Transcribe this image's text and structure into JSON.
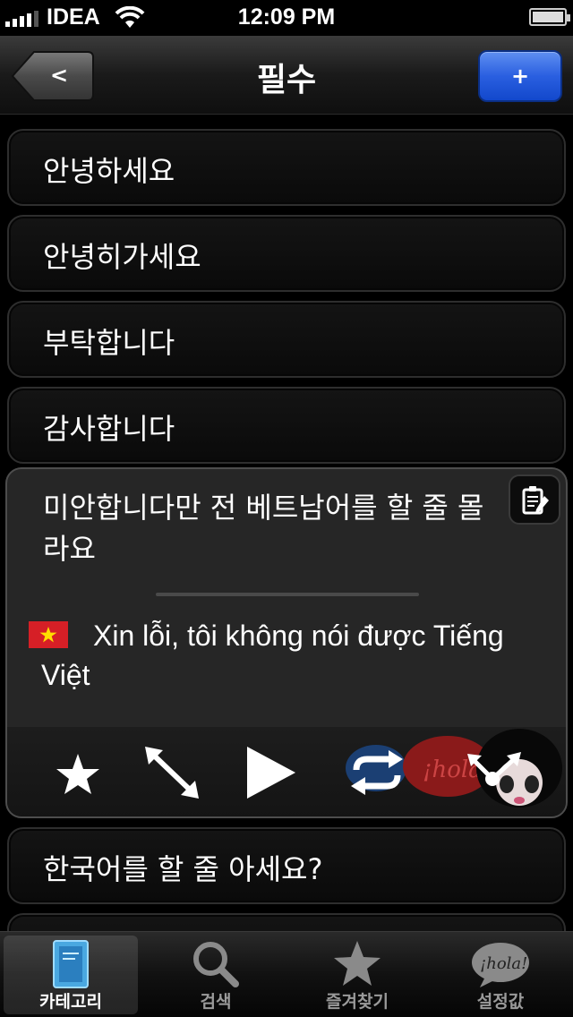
{
  "status_bar": {
    "carrier": "IDEA",
    "time": "12:09 PM"
  },
  "nav": {
    "back_label": "<",
    "title": "필수",
    "add_label": "+"
  },
  "items": [
    {
      "label": "안녕하세요"
    },
    {
      "label": "안녕히가세요"
    },
    {
      "label": "부탁합니다"
    },
    {
      "label": "감사합니다"
    }
  ],
  "expanded": {
    "korean": "미안합니다만 전 베트남어를 할 줄 몰라요",
    "vietnamese": "Xin lỗi, tôi không nói được Tiếng Việt",
    "flag_icon": "vietnam-flag-icon",
    "actions": [
      "star-icon",
      "resize-arrows-icon",
      "play-icon",
      "repeat-icon",
      "share-icon"
    ],
    "decoration_text": "¡hola!"
  },
  "next_item": {
    "label": "한국어를 할 줄 아세요?"
  },
  "tabs": [
    {
      "label": "카테고리",
      "icon": "book-icon",
      "active": true
    },
    {
      "label": "검색",
      "icon": "search-icon",
      "active": false
    },
    {
      "label": "즐겨찾기",
      "icon": "star-icon",
      "active": false
    },
    {
      "label": "설정값",
      "icon": "hola-bubble-icon",
      "active": false
    }
  ],
  "colors": {
    "accent_blue": "#2a5fe0",
    "flag_red": "#d61f26",
    "flag_yellow": "#ffdd00"
  }
}
